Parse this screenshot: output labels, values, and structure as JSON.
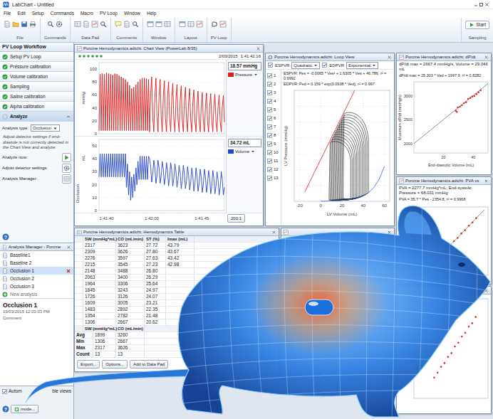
{
  "window": {
    "title": "LabChart - Untitled"
  },
  "help_glyph": "?",
  "menu": [
    "File",
    "Edit",
    "Setup",
    "Commands",
    "Macro",
    "PV Loop",
    "Window",
    "Help"
  ],
  "toolbar": {
    "groups": [
      "File",
      "Commands",
      "Data Pad",
      "Comments",
      "Window",
      "Layout",
      "PV Loop"
    ],
    "sampling": {
      "label": "Sampling",
      "start": "Start"
    }
  },
  "workflow": {
    "title": "PV Loop Workflow",
    "steps": [
      {
        "label": "Setup PV Loop",
        "done": true,
        "expanded": false
      },
      {
        "label": "Pressure calibration",
        "done": true,
        "expanded": false
      },
      {
        "label": "Volume calibration",
        "done": true,
        "expanded": false
      },
      {
        "label": "Sampling",
        "done": true,
        "expanded": false
      },
      {
        "label": "Saline calibration",
        "done": true,
        "expanded": false
      },
      {
        "label": "Alpha calibration",
        "done": true,
        "expanded": false
      },
      {
        "label": "Analyze",
        "done": false,
        "expanded": true
      }
    ],
    "analysis_type": {
      "label": "Analysis type:",
      "value": "Occlusion"
    },
    "hint": "Adjust detector settings if end-diastole is not correctly detected in the Chart View and analyze.",
    "actions": [
      "Analyze now:",
      "Adjust detector settings:",
      "Analysis Manager:"
    ]
  },
  "analysis_manager": {
    "title": "Analysis Manager - Porcine",
    "items": [
      {
        "label": "Baseline1",
        "selected": false,
        "kind": "analysis"
      },
      {
        "label": "Baseline 2",
        "selected": false,
        "kind": "analysis"
      },
      {
        "label": "Occlusion 1",
        "selected": true,
        "kind": "analysis"
      },
      {
        "label": "Occlusion 2",
        "selected": false,
        "kind": "analysis"
      },
      {
        "label": "Occlusion 3",
        "selected": false,
        "kind": "analysis"
      },
      {
        "label": "New analysis",
        "selected": false,
        "kind": "new"
      }
    ],
    "detail": {
      "name": "Occlusion 1",
      "date": "19/03/2015 12:03:03 PM",
      "comment": "Comment"
    }
  },
  "bottom_bar": {
    "checked": true,
    "label_parts": [
      "Autom",
      "ble views"
    ],
    "button": "mode..."
  },
  "chart_view": {
    "title": "Porcine Hemodynamics.adicht: Chart View (PowerLab 8/35)",
    "date": "2/03/2015",
    "time": "1:41:42.16",
    "channels": [
      {
        "name": "Pressure",
        "unit": "mmHg",
        "reading": "18.57 mmHg",
        "color": "#d81e1e",
        "ticks": [
          "100",
          "80",
          "60",
          "40",
          "20",
          "0"
        ],
        "values": [
          5,
          92,
          5,
          93,
          5,
          92,
          5,
          94,
          5,
          93,
          5,
          92,
          5,
          91,
          5,
          93,
          5,
          92,
          5,
          90,
          5,
          88,
          5,
          86,
          5,
          84,
          5,
          80,
          5,
          75,
          5,
          70,
          5,
          72,
          5,
          76,
          5,
          80,
          5,
          84,
          5,
          86,
          5,
          86,
          5,
          85,
          5,
          84,
          3,
          62,
          88,
          26,
          3,
          60,
          86,
          26,
          3,
          59,
          84,
          25,
          3,
          57,
          82,
          25,
          3,
          56,
          80,
          24,
          3,
          55,
          78,
          23,
          3,
          53,
          76,
          23,
          3,
          52,
          74,
          22,
          3,
          50,
          72,
          22,
          3,
          49,
          70,
          21,
          3,
          48,
          68,
          20,
          3,
          46,
          66,
          20,
          3,
          45,
          64,
          19,
          3,
          44,
          63,
          19,
          3,
          43,
          62,
          19,
          3,
          43,
          61,
          18,
          3,
          42,
          60,
          18,
          3,
          41,
          59,
          18
        ]
      },
      {
        "name": "Volume",
        "unit": "mL",
        "reading": "34.72 mL",
        "color": "#2446c4",
        "ticks": [
          "50",
          "40",
          "30",
          "20",
          "10",
          "0"
        ],
        "values": [
          26,
          44,
          26,
          44,
          26,
          44,
          26,
          44,
          26,
          44,
          26,
          44,
          26,
          44,
          26,
          44,
          26,
          44,
          26,
          44,
          26,
          44,
          26,
          44,
          26,
          44,
          18,
          36,
          12,
          30,
          8,
          26,
          10,
          28,
          15,
          33,
          20,
          38,
          24,
          42,
          24,
          42,
          24,
          42,
          24,
          42,
          24,
          42,
          40,
          34,
          22,
          28,
          39,
          33,
          21,
          27,
          39,
          33,
          21,
          27,
          38,
          32,
          20,
          26,
          37,
          31,
          19,
          25,
          37,
          31,
          19,
          25,
          36,
          30,
          18,
          24,
          35,
          29,
          17,
          23,
          35,
          29,
          17,
          23,
          34,
          28,
          16,
          22,
          33,
          27,
          15,
          21,
          33,
          27,
          15,
          21,
          32,
          26,
          14,
          20,
          32,
          26,
          14,
          20,
          31,
          25,
          13,
          19,
          31,
          25,
          13,
          19,
          30,
          24,
          12,
          18,
          30,
          24,
          12,
          18
        ]
      }
    ],
    "comment": "Occlusion",
    "time_ticks": [
      "1:41:40",
      "1:42:00",
      "1:41:45"
    ],
    "zoom": "200:1"
  },
  "loop_view": {
    "title": "Porcine Hemodynamics.adicht: Loop View",
    "espvr": {
      "label": "ESPVR",
      "checked": true,
      "fit": "Quadratic"
    },
    "edpvr": {
      "label": "EDPVR",
      "checked": true,
      "fit": "Exponential"
    },
    "loop_list": [
      {
        "label": "1",
        "checked": true
      },
      {
        "label": "2",
        "checked": true
      },
      {
        "label": "3",
        "checked": true
      },
      {
        "label": "4",
        "checked": true
      },
      {
        "label": "5",
        "checked": true
      },
      {
        "label": "6",
        "checked": true
      },
      {
        "label": "7",
        "checked": true
      },
      {
        "label": "8",
        "checked": true
      },
      {
        "label": "9",
        "checked": true
      },
      {
        "label": "10",
        "checked": true
      },
      {
        "label": "11",
        "checked": true
      },
      {
        "label": "12",
        "checked": true
      },
      {
        "label": "13",
        "checked": true
      }
    ],
    "formulas": [
      "ESPVR: Pes = -0.0065 * Ves² + 1.6305 * Ves + 46.786, r² = 0.9992",
      "EDPVR: Ped = 0.159 * exp(0.0938 * Ved), r² = 0.997"
    ],
    "y_label": "LV Pressure (mmHg)",
    "x_label": "LV Volume (mL)",
    "x_ticks": [
      "-20",
      "0",
      "20",
      "40",
      "60"
    ],
    "espvr_line": [
      [
        -15,
        12
      ],
      [
        32,
        140
      ]
    ],
    "edpvr_curve": [
      [
        0,
        0.16
      ],
      [
        10,
        0.41
      ],
      [
        20,
        1.04
      ],
      [
        30,
        2.67
      ],
      [
        40,
        6.8
      ],
      [
        45,
        10.8
      ],
      [
        50,
        17.3
      ],
      [
        55,
        27.7
      ],
      [
        60,
        44
      ]
    ],
    "loops": [
      {
        "edv": 45,
        "esv": 21,
        "esp": 110.4,
        "edp": 10.8
      },
      {
        "edv": 43.6,
        "esv": 19.9,
        "esp": 107.4,
        "edp": 9.5
      },
      {
        "edv": 42.2,
        "esv": 18.8,
        "esp": 104.4,
        "edp": 8.3
      },
      {
        "edv": 40.8,
        "esv": 17.7,
        "esp": 101.4,
        "edp": 7.3
      },
      {
        "edv": 39.4,
        "esv": 16.6,
        "esp": 98.4,
        "edp": 6.4
      },
      {
        "edv": 38,
        "esv": 15.5,
        "esp": 95.4,
        "edp": 5.6
      },
      {
        "edv": 36.6,
        "esv": 14.4,
        "esp": 92.4,
        "edp": 4.9
      },
      {
        "edv": 35.2,
        "esv": 13.3,
        "esp": 89.3,
        "edp": 4.3
      },
      {
        "edv": 33.8,
        "esv": 12.2,
        "esp": 86.3,
        "edp": 3.8
      },
      {
        "edv": 32.4,
        "esv": 11.1,
        "esp": 83.3,
        "edp": 3.3
      },
      {
        "edv": 31,
        "esv": 10,
        "esp": 80.3,
        "edp": 2.9
      },
      {
        "edv": 29.6,
        "esv": 8.9,
        "esp": 77.3,
        "edp": 2.6
      },
      {
        "edv": 28.2,
        "esv": 7.8,
        "esp": 74.3,
        "edp": 2.2
      }
    ]
  },
  "dpdt_plot": {
    "title": "Porcine Hemodynamics.adicht: dP/dt",
    "info": "dP/dt max = 2667.4 mmHg/s, Volume = 29.046 mL",
    "formula": "dP/dt max = 25.303 * Ved + 1997.9, r² = 0.8282",
    "y_label": "Maximum dP/dt (mmHg/s)",
    "x_label": "End-diastolic Volume (mL)",
    "y_ticks": [
      "3000",
      "2500",
      "2000"
    ],
    "x_ticks": [
      "20",
      "40"
    ],
    "points": [
      [
        28.2,
        2690
      ],
      [
        29.0,
        2667
      ],
      [
        29.6,
        2760
      ],
      [
        31.0,
        2775
      ],
      [
        32.4,
        2805
      ],
      [
        33.8,
        2850
      ],
      [
        35.2,
        2870
      ],
      [
        36.6,
        2940
      ],
      [
        38.0,
        2960
      ],
      [
        39.4,
        2990
      ],
      [
        40.8,
        3000
      ],
      [
        42.2,
        3040
      ],
      [
        43.6,
        3080
      ],
      [
        45.0,
        3120
      ]
    ],
    "fit": [
      [
        0,
        1998
      ],
      [
        50,
        3263
      ]
    ]
  },
  "pva_plot": {
    "title": "Porcine Hemodynamics.adicht: PVA vs",
    "info": "PVA = 2277.7 mmHg*mL, End-systolic Pressure = 68.031 mmHg",
    "formula": "PVA = 35.7 * Pes - 2354.8, r² = 0.9968",
    "points": [
      [
        74.3,
        310
      ],
      [
        77.3,
        395
      ],
      [
        80.3,
        520
      ],
      [
        83.3,
        610
      ],
      [
        86.3,
        735
      ],
      [
        89.3,
        825
      ],
      [
        92.4,
        950
      ],
      [
        95.4,
        1040
      ],
      [
        98.4,
        1165
      ],
      [
        101.4,
        1255
      ],
      [
        104.4,
        1380
      ],
      [
        107.4,
        1470
      ],
      [
        110.4,
        1590
      ]
    ],
    "fit": [
      [
        66,
        1
      ],
      [
        117,
        1822
      ]
    ]
  },
  "plot3": {
    "points": [
      [
        28.2,
        1300
      ],
      [
        29.6,
        1420
      ],
      [
        31.0,
        1560
      ],
      [
        32.4,
        1650
      ],
      [
        33.8,
        1800
      ],
      [
        35.2,
        1890
      ],
      [
        36.6,
        2050
      ],
      [
        38.0,
        2140
      ],
      [
        39.4,
        2290
      ],
      [
        40.8,
        2380
      ],
      [
        42.2,
        2530
      ],
      [
        43.6,
        2610
      ],
      [
        45.0,
        2760
      ]
    ]
  },
  "table": {
    "title": "Porcine Hemodynamics.adicht: Hemodynamics Table",
    "columns": [
      "SW (mmHg*mL)",
      "CO (mL/min)",
      "ST (%)",
      "Imax (mL)"
    ],
    "rows": [
      [
        "2317",
        "3623",
        "27.72",
        "43.79"
      ],
      [
        "2309",
        "3626",
        "27.80",
        "43.67"
      ],
      [
        "2276",
        "3597",
        "27.63",
        "43.42"
      ],
      [
        "2215",
        "3545",
        "27.23",
        "42.98"
      ],
      [
        "2148",
        "3488",
        "26.80"
      ],
      [
        "2063",
        "3400",
        "26.29"
      ],
      [
        "1964",
        "3306",
        "25.64"
      ],
      [
        "1845",
        "3243",
        "24.97"
      ],
      [
        "1726",
        "3126",
        "24.07"
      ],
      [
        "1609",
        "3005",
        "23.21"
      ],
      [
        "1483",
        "2892",
        "22.35"
      ],
      [
        "1354",
        "2782",
        "21.48"
      ],
      [
        "1306",
        "2667",
        "20.62"
      ]
    ],
    "summary_columns": [
      "SW (mmHg*mL)",
      "CO (mL/min)"
    ],
    "summary": [
      {
        "label": "Avg",
        "values": [
          "1899",
          "3260"
        ]
      },
      {
        "label": "Min",
        "values": [
          "1306",
          "2667"
        ]
      },
      {
        "label": "Max",
        "values": [
          "2317",
          "3626"
        ]
      },
      {
        "label": "Count",
        "values": [
          "13",
          "13"
        ]
      }
    ],
    "buttons": [
      "Export...",
      "Options...",
      "Add to Data Pad"
    ]
  }
}
